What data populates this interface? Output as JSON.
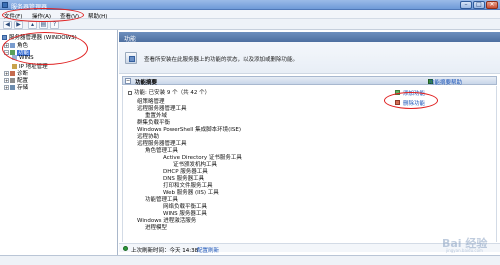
{
  "window": {
    "title": "服务器管理器"
  },
  "menu": {
    "items": [
      "文件(F)",
      "操作(A)",
      "查看(V)",
      "帮助(H)"
    ]
  },
  "toolbar": {
    "buttons": [
      "back-icon",
      "forward-icon",
      "up-icon",
      "show-hide-tree-icon",
      "help-icon"
    ]
  },
  "tree": {
    "root": "服务器管理器 (WINDOWS)",
    "nodes": [
      "角色",
      "功能",
      "WINS",
      "诊断",
      "配置",
      "存储"
    ],
    "wins_child": "WINS",
    "wins_manager": "IP 地址管理"
  },
  "content": {
    "header": "功能",
    "intro": "查看所安装在此服务器上的功能的状态，以及添加或删除功能。",
    "section": {
      "title": "功能摘要",
      "help_link": "功能摘要帮助",
      "installed_count": "功能: 已安装 9 个（共 42 个）",
      "features": [
        "组策略管理",
        "远程服务器管理工具",
        "重置外域",
        "群集负载平衡",
        "Windows PowerShell 集成脚本环境(ISE)",
        "远程协助",
        "远程服务器管理工具",
        "角色管理工具",
        "Active Directory 证书服务工具",
        "证书颁发机构工具",
        "DHCP 服务器工具",
        "DNS 服务器工具",
        "打印和文件服务工具",
        "Web 服务器 (IIS) 工具",
        "功能管理工具",
        "网络负载平衡工具",
        "WINS 服务器工具",
        "Windows 进程激活服务",
        "进程模型"
      ],
      "actions": {
        "add": "添加功能",
        "remove": "删除功能"
      }
    },
    "refresh": {
      "text": "上次刷新时间：今天 14:38",
      "link": "配置刷新"
    }
  },
  "watermark": {
    "brand": "Bai 经验",
    "url": "jingyan.baidu.com"
  },
  "colors": {
    "title_bar": "#6f9ad8",
    "header": "#4d6f9f",
    "link": "#1c55b8",
    "annotation": "#e02020"
  }
}
